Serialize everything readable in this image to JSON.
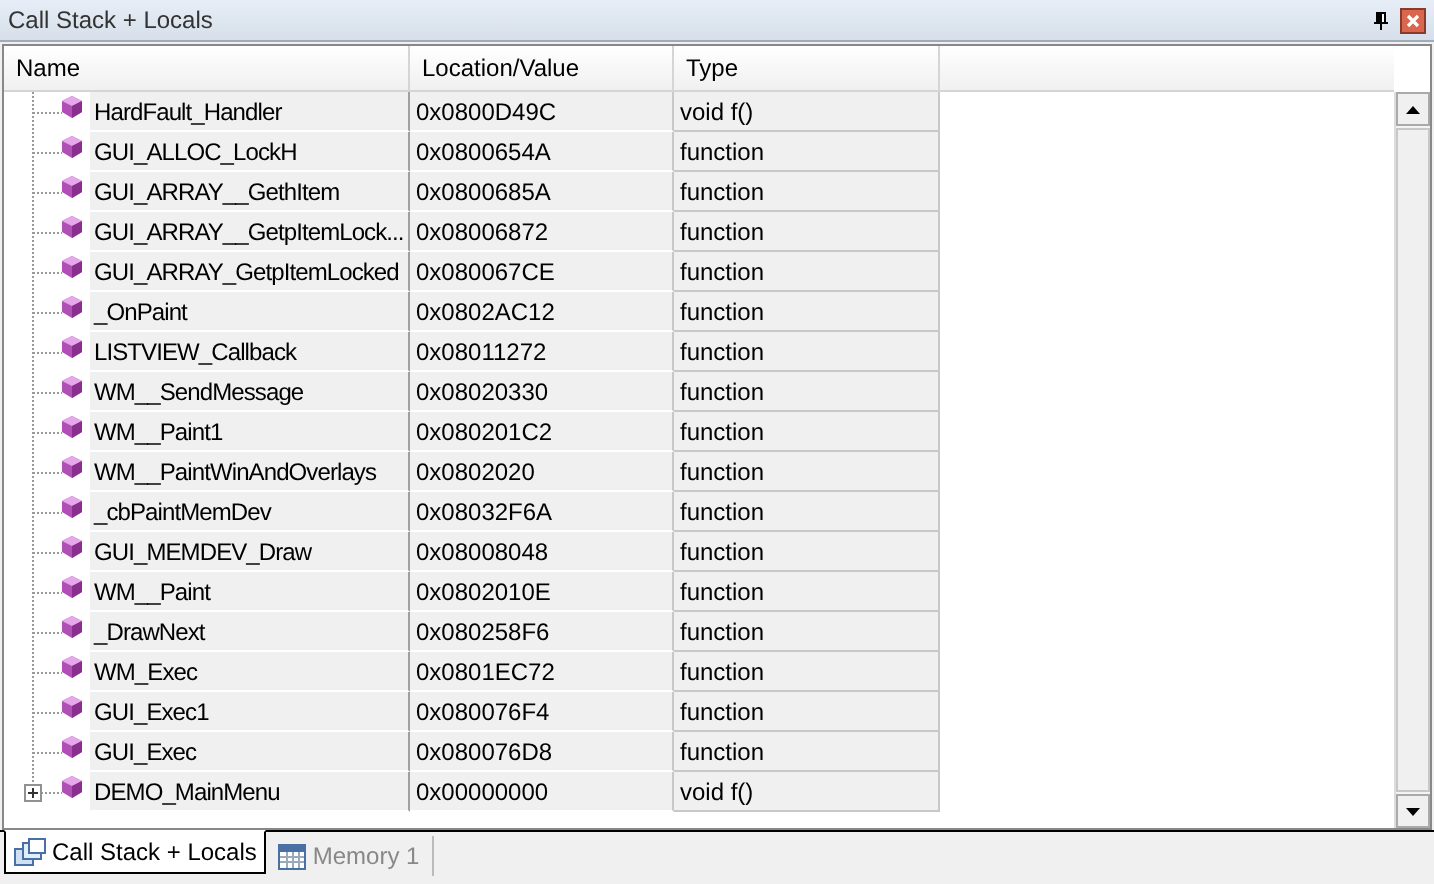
{
  "window": {
    "title": "Call Stack + Locals"
  },
  "table": {
    "columns": [
      "Name",
      "Location/Value",
      "Type"
    ],
    "rows": [
      {
        "kind": "leaf",
        "name": "HardFault_Handler",
        "location": "0x0800D49C",
        "type": "void f()"
      },
      {
        "kind": "leaf",
        "name": "GUI_ALLOC_LockH",
        "location": "0x0800654A",
        "type": "function"
      },
      {
        "kind": "leaf",
        "name": "GUI_ARRAY__GethItem",
        "location": "0x0800685A",
        "type": "function"
      },
      {
        "kind": "leaf",
        "name": "GUI_ARRAY__GetpItemLock...",
        "location": "0x08006872",
        "type": "function"
      },
      {
        "kind": "leaf",
        "name": "GUI_ARRAY_GetpItemLocked",
        "location": "0x080067CE",
        "type": "function"
      },
      {
        "kind": "leaf",
        "name": "_OnPaint",
        "location": "0x0802AC12",
        "type": "function"
      },
      {
        "kind": "leaf",
        "name": "LISTVIEW_Callback",
        "location": "0x08011272",
        "type": "function"
      },
      {
        "kind": "leaf",
        "name": "WM__SendMessage",
        "location": "0x08020330",
        "type": "function"
      },
      {
        "kind": "leaf",
        "name": "WM__Paint1",
        "location": "0x080201C2",
        "type": "function"
      },
      {
        "kind": "leaf",
        "name": "WM__PaintWinAndOverlays",
        "location": "0x0802020",
        "type": "function"
      },
      {
        "kind": "leaf",
        "name": "_cbPaintMemDev",
        "location": "0x08032F6A",
        "type": "function"
      },
      {
        "kind": "leaf",
        "name": "GUI_MEMDEV_Draw",
        "location": "0x08008048",
        "type": "function"
      },
      {
        "kind": "leaf",
        "name": "WM__Paint",
        "location": "0x0802010E",
        "type": "function"
      },
      {
        "kind": "leaf",
        "name": "_DrawNext",
        "location": "0x080258F6",
        "type": "function"
      },
      {
        "kind": "leaf",
        "name": "WM_Exec",
        "location": "0x0801EC72",
        "type": "function"
      },
      {
        "kind": "leaf",
        "name": "GUI_Exec1",
        "location": "0x080076F4",
        "type": "function"
      },
      {
        "kind": "leaf",
        "name": "GUI_Exec",
        "location": "0x080076D8",
        "type": "function"
      },
      {
        "kind": "collapsed",
        "name": "DEMO_MainMenu",
        "location": "0x00000000",
        "type": "void f()"
      }
    ]
  },
  "tabs": [
    {
      "label": "Call Stack + Locals",
      "selected": true
    },
    {
      "label": "Memory 1",
      "selected": false
    }
  ]
}
